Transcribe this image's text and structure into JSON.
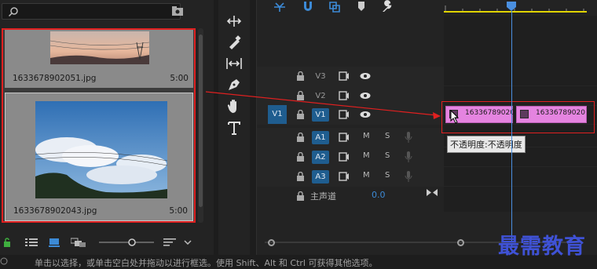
{
  "project": {
    "search_placeholder": "",
    "clips": [
      {
        "name": "1633678902051.jpg",
        "duration": "5:00"
      },
      {
        "name": "1633678902043.jpg",
        "duration": "5:00"
      }
    ]
  },
  "timeline": {
    "tracks": [
      {
        "label": "V3",
        "type": "video",
        "targeted": false
      },
      {
        "label": "V2",
        "type": "video",
        "targeted": false
      },
      {
        "label": "V1",
        "type": "video",
        "targeted": true
      },
      {
        "label": "A1",
        "type": "audio",
        "targeted": true,
        "mute": "M",
        "solo": "S"
      },
      {
        "label": "A2",
        "type": "audio",
        "targeted": true,
        "mute": "M",
        "solo": "S"
      },
      {
        "label": "A3",
        "type": "audio",
        "targeted": true,
        "mute": "M",
        "solo": "S"
      }
    ],
    "source_patch_label": "V1",
    "master": {
      "label": "主声道",
      "value": "0.0"
    },
    "clips": [
      {
        "name": "16336789020"
      },
      {
        "name": "16336789020"
      }
    ],
    "tooltip": "不透明度:不透明度"
  },
  "status": {
    "text": "单击以选择，或单击空白处并拖动以进行框选。使用 Shift、Alt 和 Ctrl 可获得其他选项。"
  },
  "watermark": "最需教育",
  "colors": {
    "accent": "#1f5d8f",
    "clip": "#e584e0",
    "highlight": "#e02020",
    "playhead": "#4a8fe0",
    "in_out": "#e0d400"
  }
}
